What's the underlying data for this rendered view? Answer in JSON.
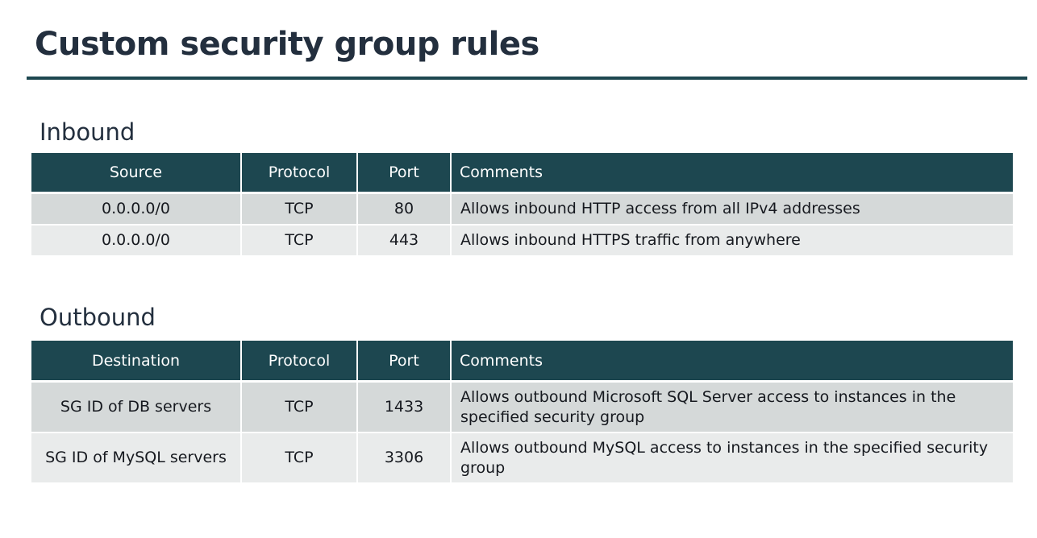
{
  "title": "Custom security group rules",
  "inbound": {
    "heading": "Inbound",
    "headers": [
      "Source",
      "Protocol",
      "Port",
      "Comments"
    ],
    "rows": [
      {
        "source": "0.0.0.0/0",
        "protocol": "TCP",
        "port": "80",
        "comments": "Allows inbound HTTP access from all IPv4 addresses"
      },
      {
        "source": "0.0.0.0/0",
        "protocol": "TCP",
        "port": "443",
        "comments": "Allows inbound HTTPS traffic from anywhere"
      }
    ]
  },
  "outbound": {
    "heading": "Outbound",
    "headers": [
      "Destination",
      "Protocol",
      "Port",
      "Comments"
    ],
    "rows": [
      {
        "destination": "SG ID of DB servers",
        "protocol": "TCP",
        "port": "1433",
        "comments": "Allows outbound Microsoft SQL Server access to instances in the specified security group"
      },
      {
        "destination": "SG ID of MySQL servers",
        "protocol": "TCP",
        "port": "3306",
        "comments": "Allows outbound MySQL access to instances in the specified security group"
      }
    ]
  },
  "colors": {
    "header_background": "#1d4750",
    "row_odd": "#d5d9d9",
    "row_even": "#e9ebeb",
    "title_text": "#232f3e"
  }
}
